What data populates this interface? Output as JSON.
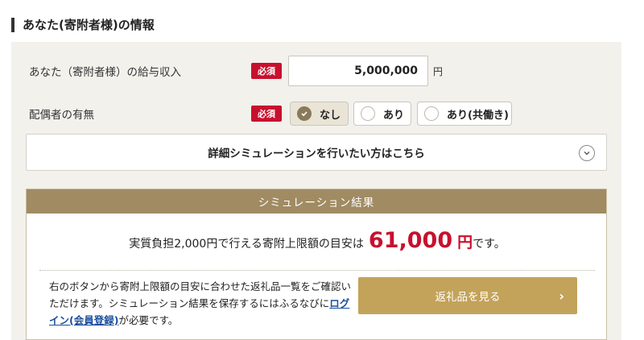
{
  "section": {
    "title": "あなた(寄附者様)の情報"
  },
  "income": {
    "label": "あなた（寄附者様）の給与収入",
    "required": "必須",
    "value": "5,000,000",
    "unit": "円"
  },
  "spouse": {
    "label": "配偶者の有無",
    "required": "必須",
    "options": [
      {
        "label": "なし",
        "selected": true
      },
      {
        "label": "あり",
        "selected": false
      },
      {
        "label": "あり(共働き)",
        "selected": false
      }
    ]
  },
  "detail": {
    "label": "詳細シミュレーションを行いたい方はこちら"
  },
  "result": {
    "header": "シミュレーション結果",
    "prefix": "実質負担2,000円で行える寄附上限額の目安は",
    "amount": "61,000",
    "yen": "円",
    "suffix": "です。",
    "note_part1": "右のボタンから寄附上限額の目安に合わせた返礼品一覧をご確認いただけます。シミュレーション結果を保存するにはふるなびに",
    "login_link": "ログイン(会員登録)",
    "note_part2": "が必要です。",
    "button_label": "返礼品を見る",
    "button_arrow": "›"
  },
  "colors": {
    "required_badge": "#c8102e",
    "result_header": "#a08b63",
    "gift_button": "#c3a35a",
    "amount": "#c8102e"
  }
}
